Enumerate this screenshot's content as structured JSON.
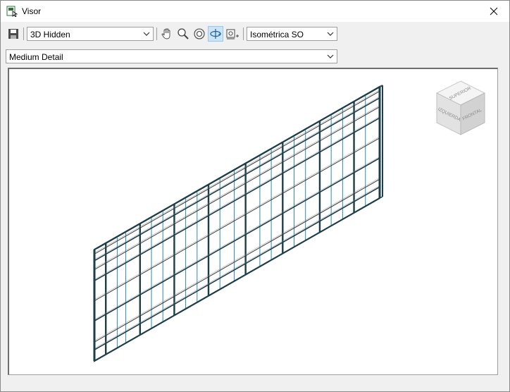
{
  "window": {
    "title": "Visor"
  },
  "toolbar": {
    "visual_style": "3D Hidden",
    "view_orientation": "Isométrica SO",
    "detail_level": "Medium Detail"
  },
  "viewcube": {
    "top_label": "SUPERIOR",
    "left_label": "IZQUIERDA",
    "front_label": "FRONTAL"
  },
  "colors": {
    "model_edge": "#1c3d4a",
    "model_glass": "#2a8ab0",
    "active_tool": "#cce4f7"
  }
}
